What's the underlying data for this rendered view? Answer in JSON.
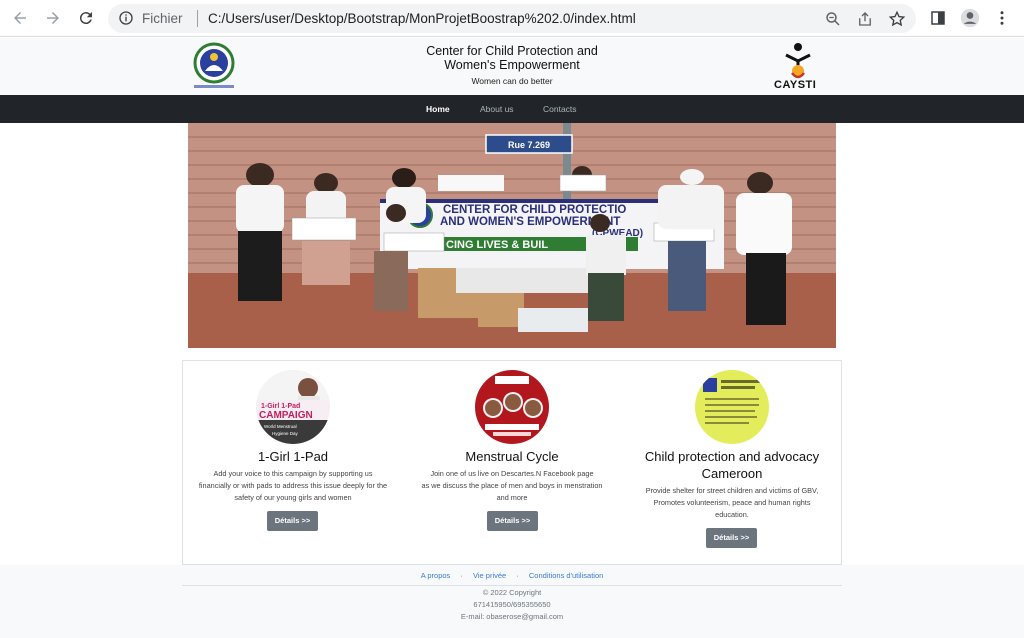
{
  "browser": {
    "scheme": "Fichier",
    "url": "C:/Users/user/Desktop/Bootstrap/MonProjetBoostrap%202.0/index.html"
  },
  "header": {
    "title_line1": "Center for Child Protection and",
    "title_line2": "Women's Empowerment",
    "tagline": "Women can do better",
    "right_logo_text": "CAYSTI"
  },
  "nav": {
    "items": [
      {
        "label": "Home",
        "active": true
      },
      {
        "label": "About us",
        "active": false
      },
      {
        "label": "Contacts",
        "active": false
      }
    ]
  },
  "hero": {
    "street_sign": "Rue 7.269",
    "banner_line1": "CENTER FOR CHILD PROTECTIO",
    "banner_line2": "AND WOMEN'S EMPOWERMENT",
    "banner_line3": "(CPWEAD)",
    "banner_line4": "CING LIVES & BUIL"
  },
  "cards": [
    {
      "title": "1-Girl 1-Pad",
      "text_lines": [
        "Add your voice to this campaign by supporting us",
        "financially or with pads to address this issue deeply for the",
        "safety of our young girls and women"
      ],
      "button": "Détails >>",
      "image_caption": "1-Girl 1-Pad CAMPAIGN"
    },
    {
      "title": "Menstrual Cycle",
      "text_lines": [
        "Join one of us live on Descartes.N Facebook page",
        "as we discuss the place of men and boys in menstration",
        "and more"
      ],
      "button": "Détails >>"
    },
    {
      "title_line1": "Child protection and advocacy",
      "title_line2": "Cameroon",
      "text_lines": [
        "Provide shelter for street children and victims of GBV,",
        "Promotes volunteerism, peace and human rights",
        "education."
      ],
      "button": "Détails >>"
    }
  ],
  "footer": {
    "links": [
      "A propos",
      "Vie privée",
      "Conditions d'utilisation"
    ],
    "separator": "·",
    "copyright": "© 2022 Copyright",
    "phone": "671415950/695355650",
    "email": "E-mail: obaserose@gmail.com"
  },
  "colors": {
    "navbar": "#212529",
    "header_bg": "#f8f9fa",
    "button": "#6c757d",
    "link": "#3d7bd6"
  }
}
